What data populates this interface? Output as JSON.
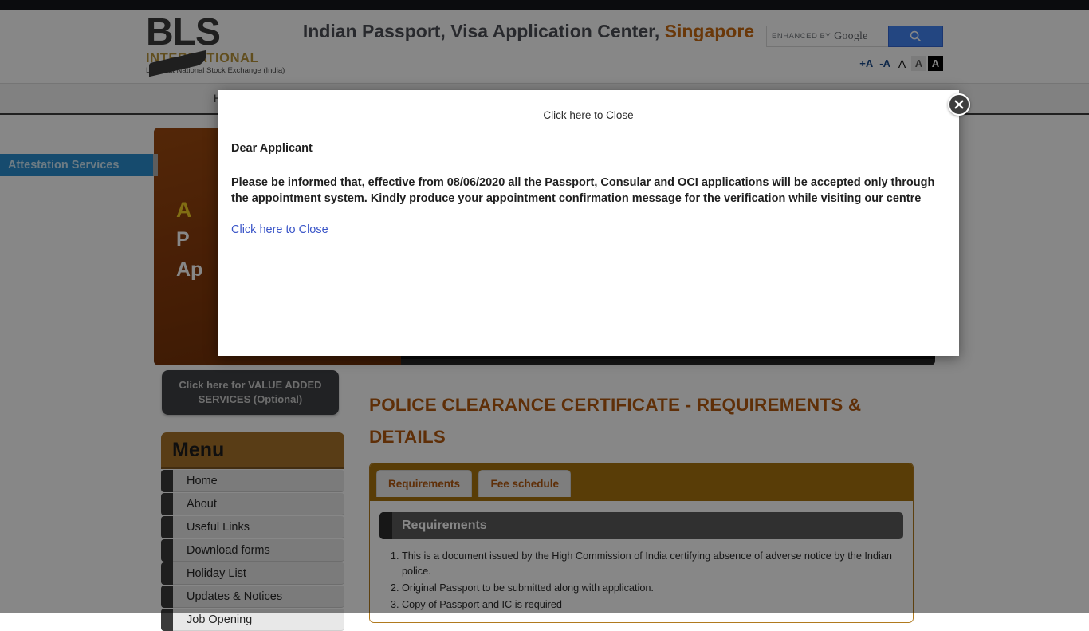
{
  "header": {
    "logo": {
      "brand": "BLS",
      "subtitle": "INTERNATIONAL",
      "listing": "Listed at National Stock Exchange (India)"
    },
    "title_line1": "Indian Passport, Visa Application Center,",
    "title_line2": "Singapore",
    "search": {
      "enhanced_label": "ENHANCED BY",
      "provider": "Google",
      "placeholder": "",
      "value": "",
      "button_icon": "search-icon"
    },
    "font_size_controls": [
      {
        "label": "+A",
        "state": "normal"
      },
      {
        "label": "-A",
        "state": "normal"
      },
      {
        "label": "A",
        "state": "plain"
      },
      {
        "label": "A",
        "state": "light"
      },
      {
        "label": "A",
        "state": "dark"
      }
    ]
  },
  "nav": {
    "items": [
      "H"
    ]
  },
  "side_tab": {
    "label": "Attestation Services"
  },
  "banner": {
    "line1": "A",
    "line2": "P",
    "line3": "Ap"
  },
  "sidebar": {
    "value_added_button": "Click here for VALUE ADDED SERVICES (Optional)",
    "menu_title": "Menu",
    "items": [
      {
        "label": "Home"
      },
      {
        "label": "About"
      },
      {
        "label": "Useful Links"
      },
      {
        "label": "Download forms"
      },
      {
        "label": "Holiday List"
      },
      {
        "label": "Updates & Notices"
      },
      {
        "label": "Job Opening"
      }
    ]
  },
  "main": {
    "heading": "POLICE CLEARANCE CERTIFICATE - REQUIREMENTS & DETAILS",
    "tabs": [
      {
        "label": "Requirements",
        "active": true
      },
      {
        "label": "Fee schedule",
        "active": false
      }
    ],
    "panel_title": "Requirements",
    "requirements": [
      "This is a document issued by the High Commission of India certifying absence of adverse notice by the Indian police.",
      "Original Passport to be submitted along with application.",
      "Copy of Passport and IC is required"
    ]
  },
  "modal": {
    "top_close_label": "Click here to Close",
    "salutation": "Dear Applicant",
    "message": "Please be informed that, effective from 08/06/2020 all the Passport, Consular and OCI applications will be accepted only through the appointment system. Kindly produce your appointment confirmation message for the verification while visiting our centre",
    "bottom_close_label": "Click here to Close",
    "close_icon": "close-circle-icon"
  },
  "colors": {
    "brand_orange": "#c96a12",
    "menu_header": "#a9742b",
    "tab_bar": "#a8740f",
    "accent_blue": "#2a8fd0",
    "link_blue": "#3a55c8",
    "google_blue": "#4285f4"
  }
}
